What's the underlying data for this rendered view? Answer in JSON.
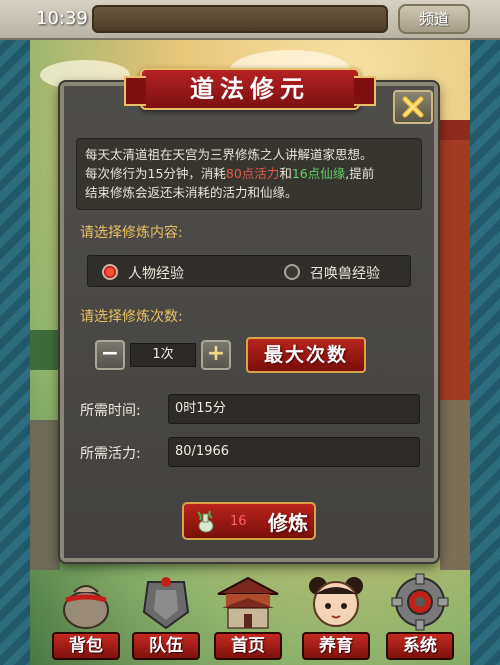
{
  "status_bar": {
    "time": "10:39",
    "channel_button": "频道"
  },
  "dialog": {
    "title": "道法修元",
    "description": {
      "line1": "每天太清道祖在天宫为三界修炼之人讲解道家思想。",
      "line2_prefix": "每次修行为15分钟，消耗",
      "line2_vitality": "80点活力",
      "line2_mid": "和",
      "line2_immortal": "16点仙缘",
      "line2_suffix": ",提前",
      "line3": "结束修炼会返还未消耗的活力和仙缘。"
    },
    "select_content_label": "请选择修炼内容:",
    "options": [
      {
        "label": "人物经验",
        "selected": true
      },
      {
        "label": "召唤兽经验",
        "selected": false
      }
    ],
    "select_count_label": "请选择修炼次数:",
    "quantity": "1次",
    "minus_label": "−",
    "plus_label": "+",
    "max_button": "最大次数",
    "time_label": "所需时间:",
    "time_value": "0时15分",
    "vitality_label": "所需活力:",
    "vitality_value": "80/1966",
    "cultivate_cost": "16",
    "cultivate_button": "修炼"
  },
  "bottom_nav": [
    {
      "label": "背包",
      "icon": "bag-icon"
    },
    {
      "label": "队伍",
      "icon": "team-shield-icon"
    },
    {
      "label": "首页",
      "icon": "palace-icon"
    },
    {
      "label": "养育",
      "icon": "child-icon"
    },
    {
      "label": "系统",
      "icon": "gear-icon"
    }
  ],
  "colors": {
    "accent_red": "#b52222",
    "gold_border": "#e7c067",
    "label_gold": "#e9c060",
    "highlight_red": "#e05a4a",
    "highlight_green": "#63d36b"
  }
}
